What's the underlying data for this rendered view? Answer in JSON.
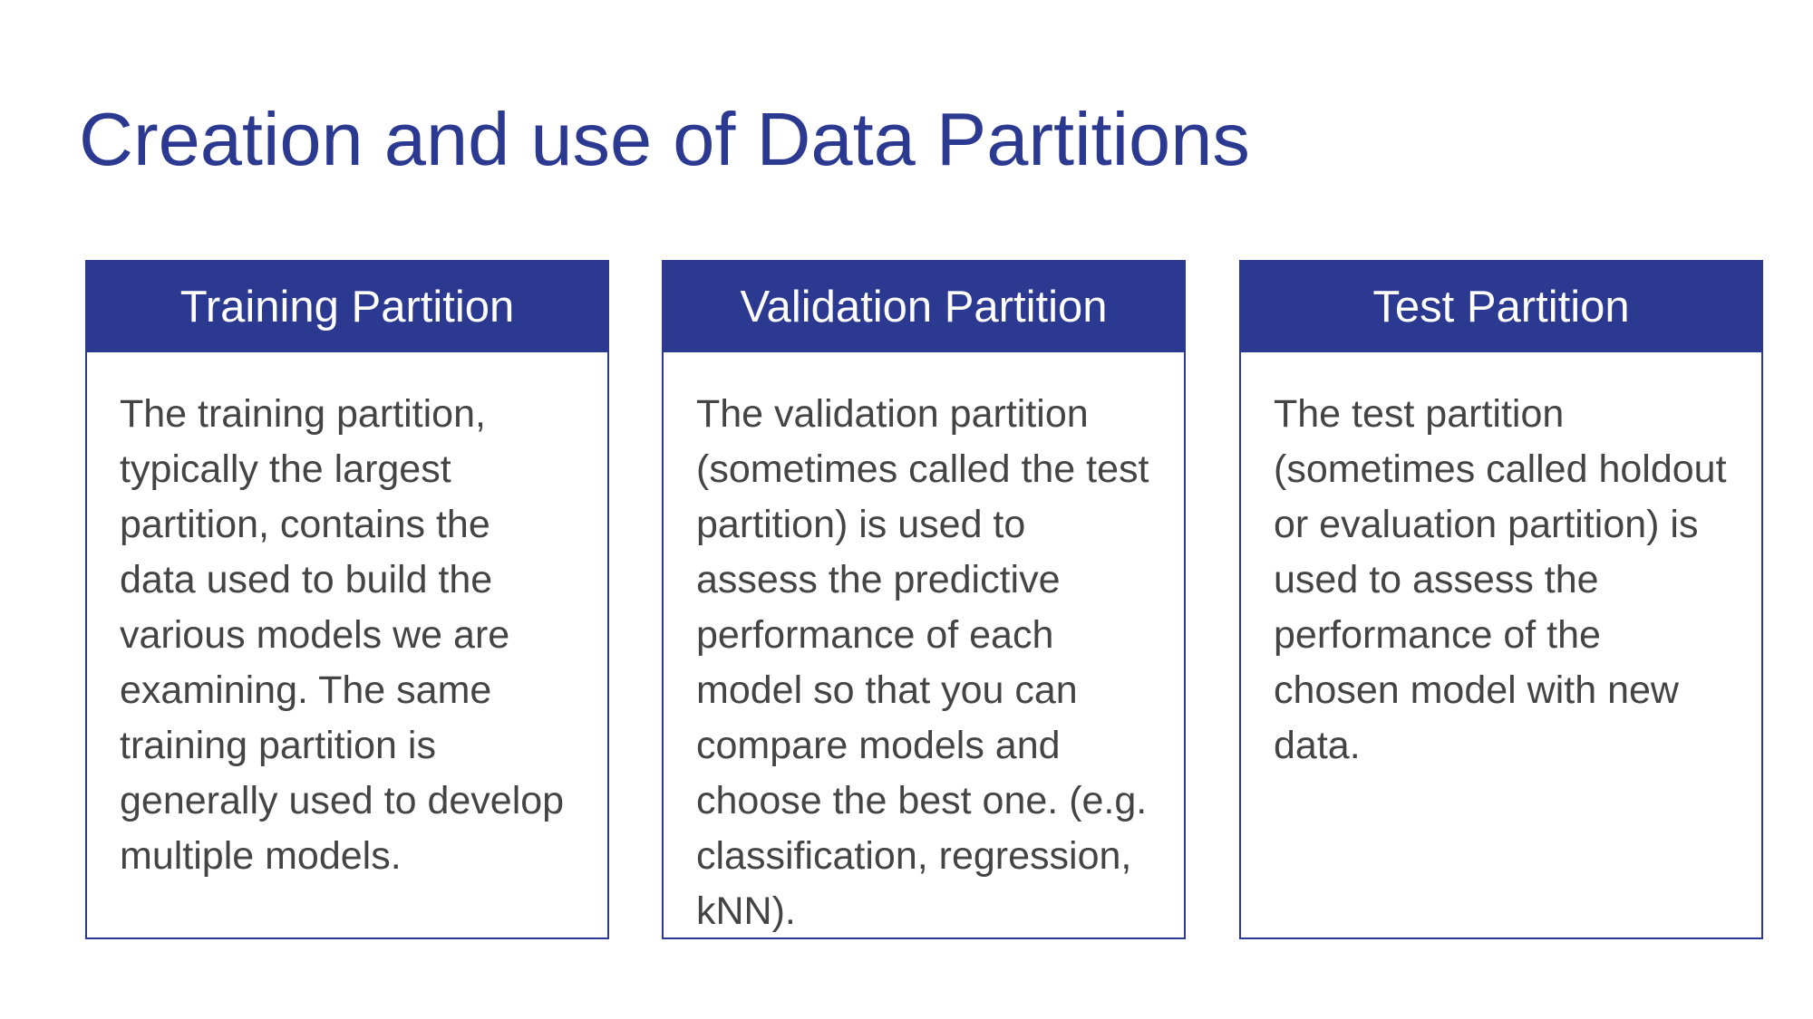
{
  "title": "Creation and use of Data Partitions",
  "colors": {
    "accent": "#2c3990",
    "body_text": "#444444",
    "background": "#ffffff"
  },
  "cards": [
    {
      "heading": "Training Partition",
      "text": "The training partition, typically the largest partition, contains the data used to build the various models we are examining. The same training partition is generally used to develop multiple models."
    },
    {
      "heading": "Validation Partition",
      "text": "The validation partition (sometimes called the test partition) is used to assess the predictive performance of each model so that you can compare models and choose the best one. (e.g. classification, regression, kNN)."
    },
    {
      "heading": "Test Partition",
      "text": "The test partition (sometimes called holdout or evaluation partition) is used to assess the performance of the chosen model with new data."
    }
  ]
}
